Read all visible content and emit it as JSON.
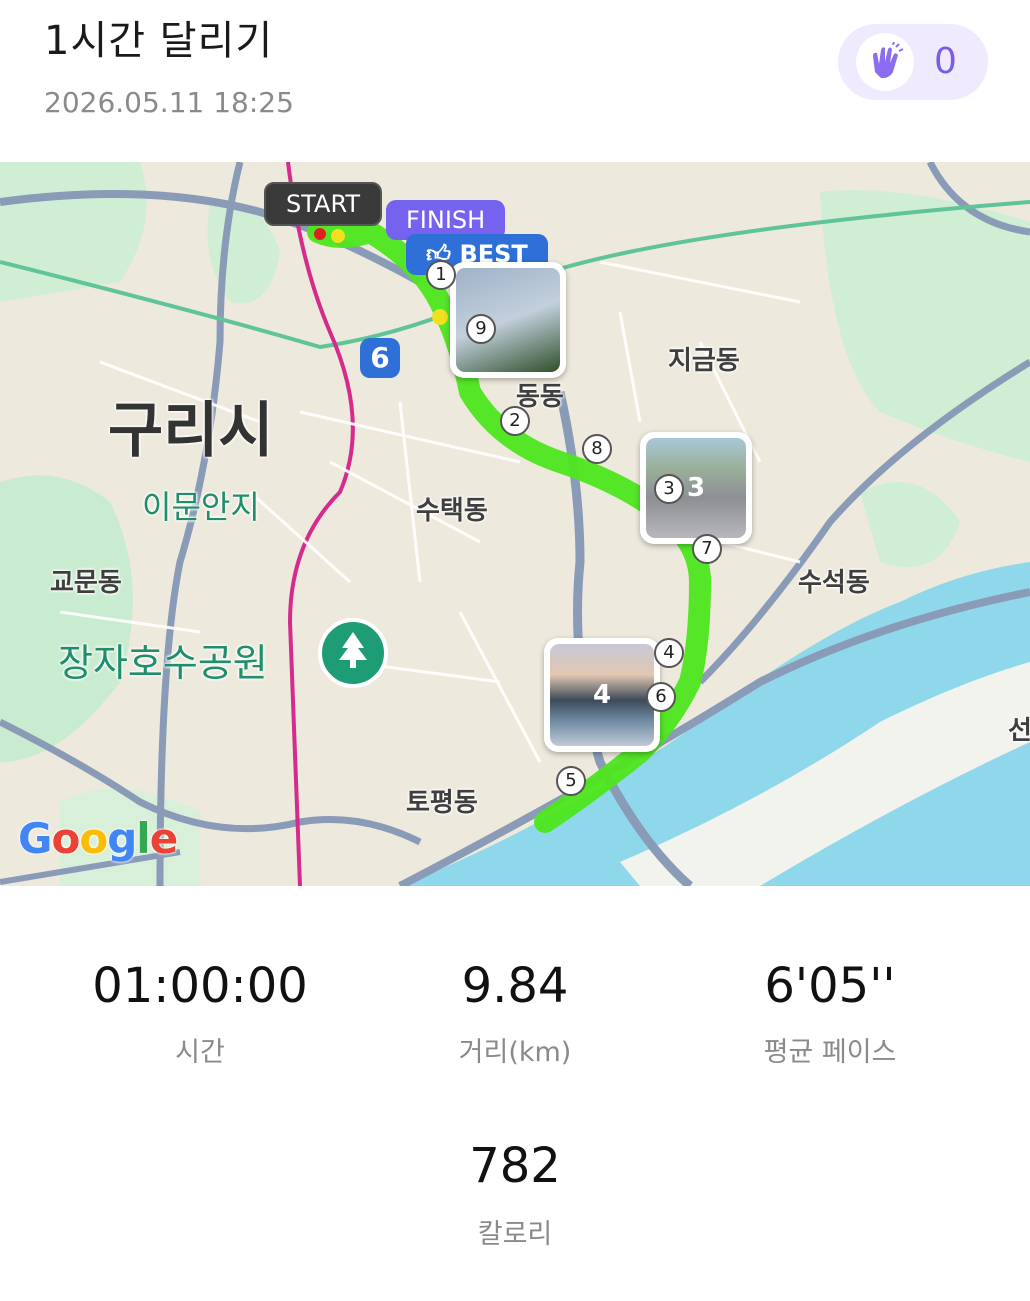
{
  "header": {
    "title": "1시간 달리기",
    "datetime": "2026.05.11 18:25",
    "clap_count": "0"
  },
  "map": {
    "city_label": "구리시",
    "place_labels": [
      "지금동",
      "동동",
      "수택동",
      "이문안지",
      "교문동",
      "수석동",
      "토평동",
      "장자호수공원",
      "선"
    ],
    "badges": {
      "start": "START",
      "finish": "FINISH",
      "best": "BEST"
    },
    "route_number": "6",
    "km_markers": [
      "1",
      "2",
      "3",
      "4",
      "5",
      "6",
      "7",
      "8",
      "9"
    ],
    "photo_labels": [
      "9",
      "3",
      "4"
    ],
    "attribution": "Google",
    "colors": {
      "route": "#4ee61e",
      "water": "#8fd8ec",
      "park": "#c9ebcf",
      "road": "#8a9bb8",
      "rail": "#d62a8c"
    }
  },
  "stats": [
    {
      "value": "01:00:00",
      "label": "시간"
    },
    {
      "value": "9.84",
      "label": "거리(km)"
    },
    {
      "value": "6'05''",
      "label": "평균 페이스"
    },
    {
      "value": "782",
      "label": "칼로리"
    }
  ]
}
